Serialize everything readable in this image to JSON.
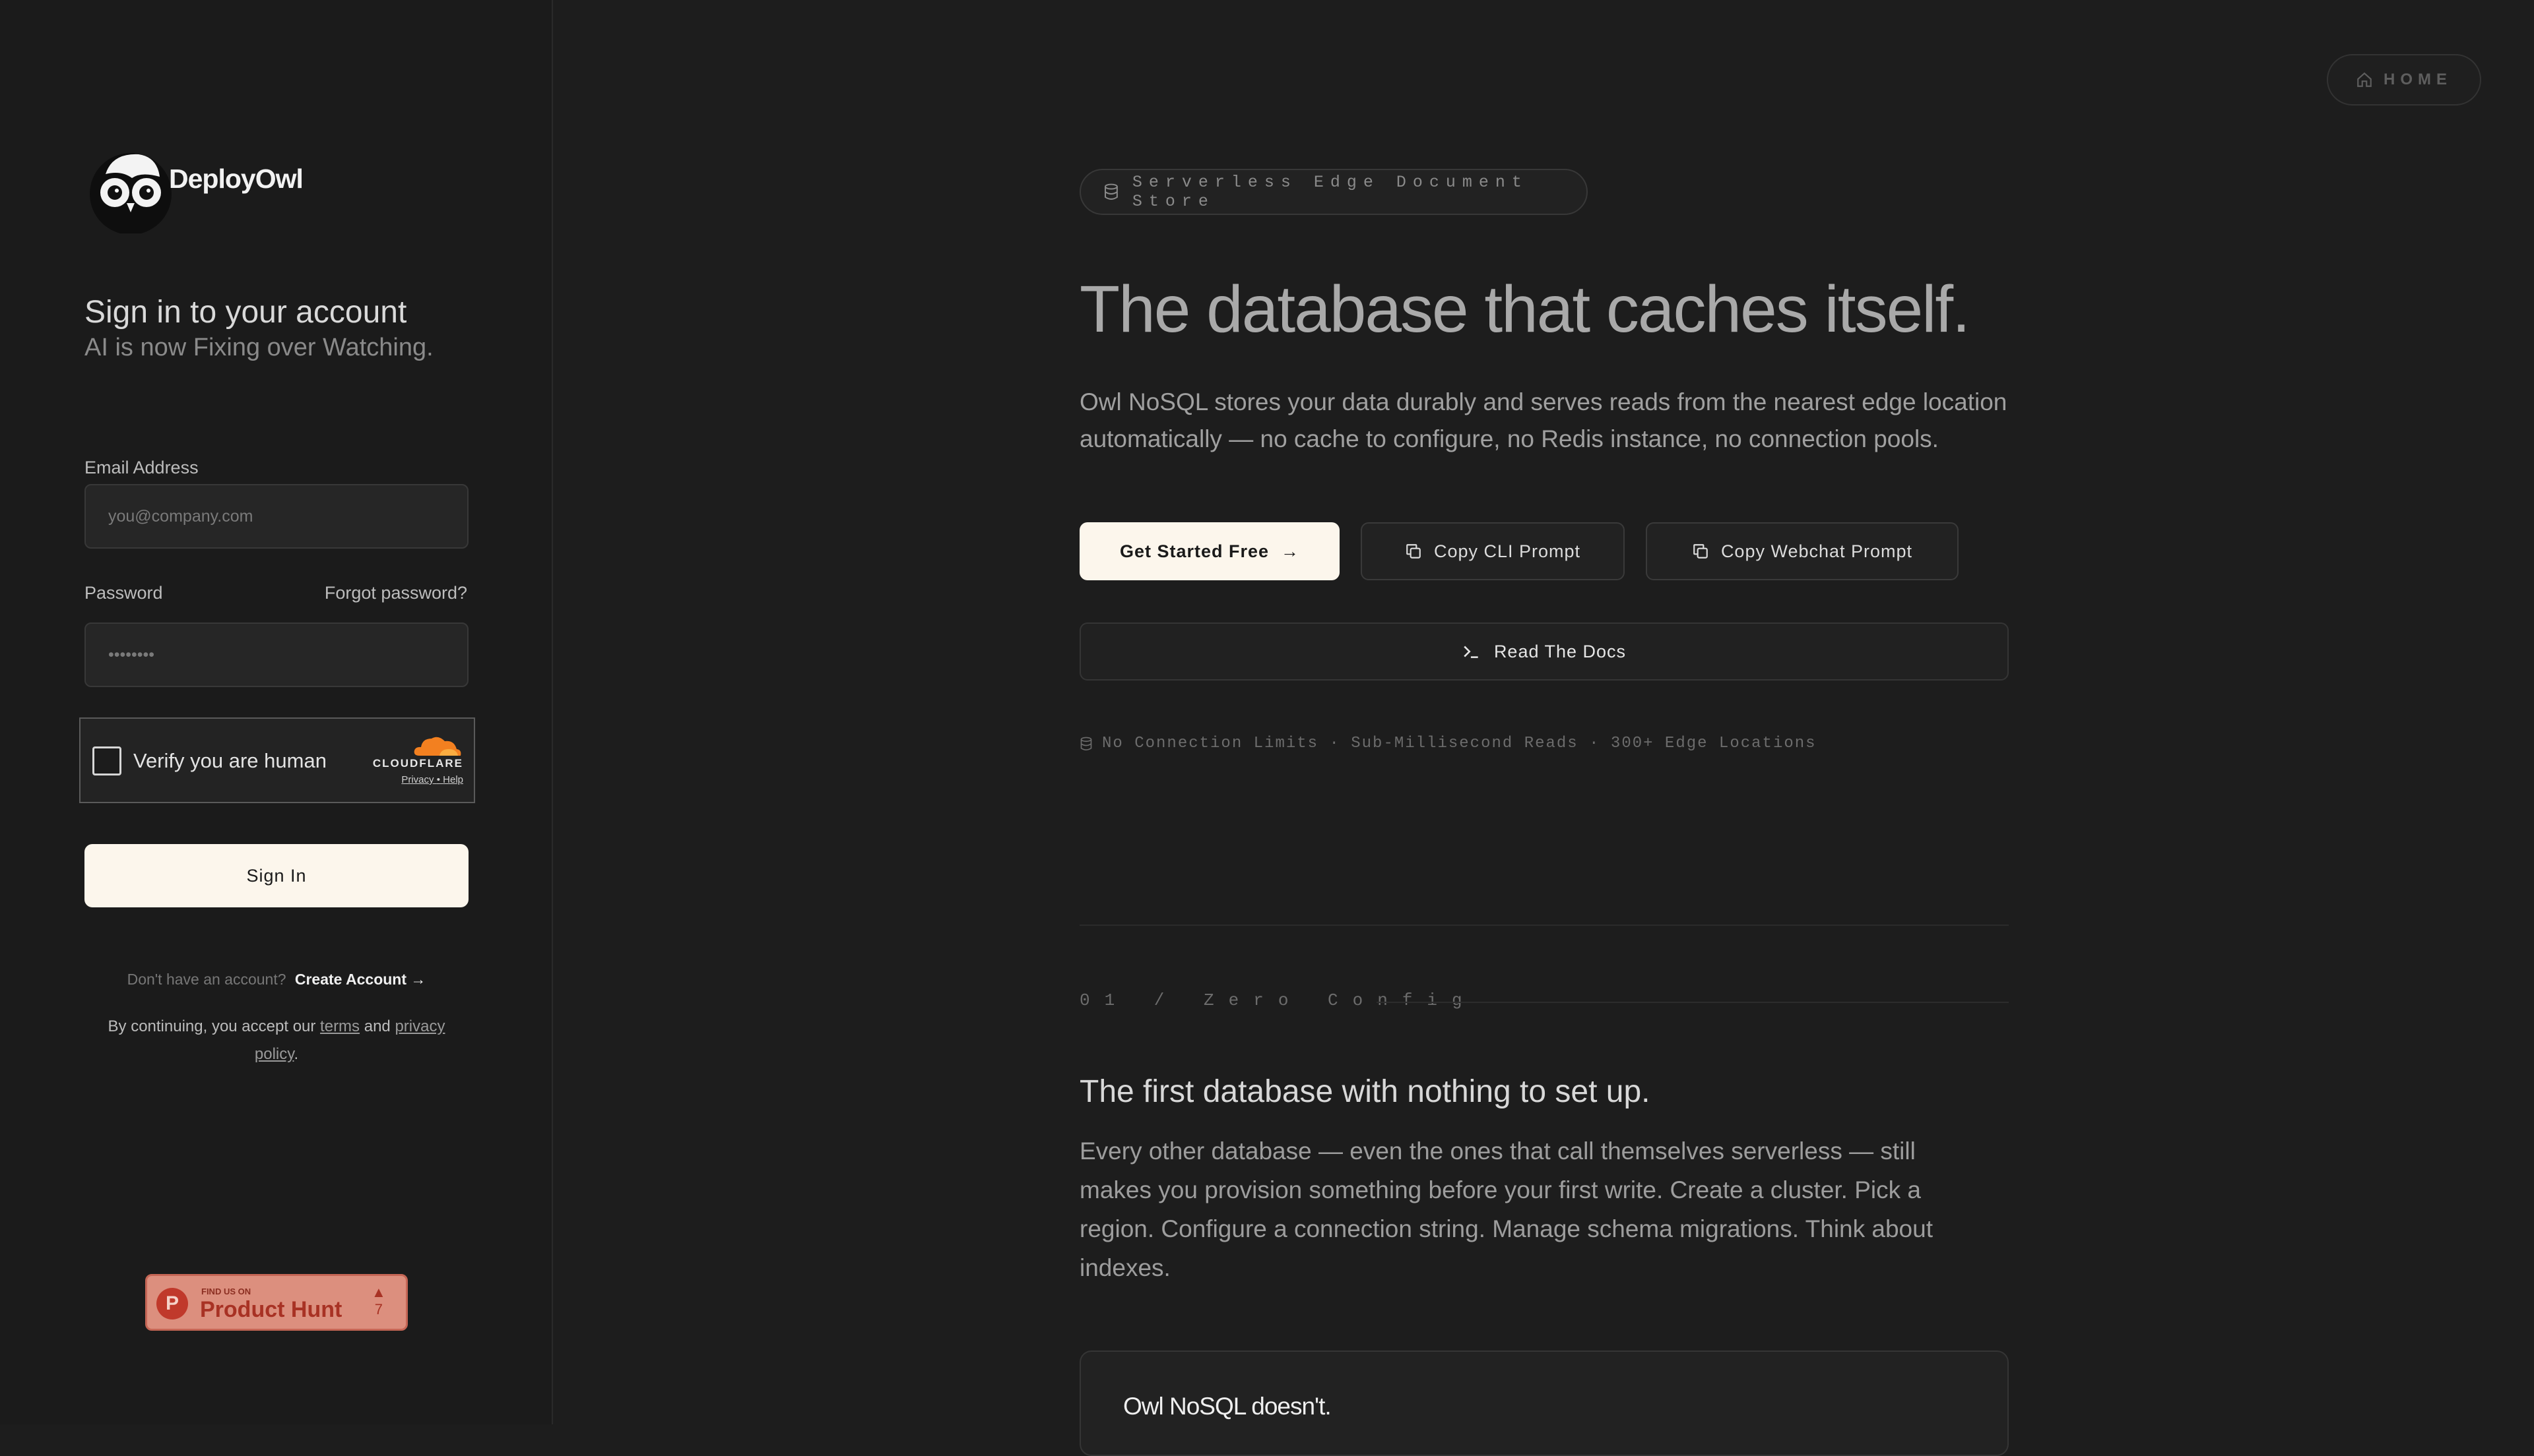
{
  "auth": {
    "brand": "DeployOwl",
    "title": "Sign in to your account",
    "subtitle": "AI is now Fixing over Watching.",
    "email_label": "Email Address",
    "email_placeholder": "you@company.com",
    "password_label": "Password",
    "forgot": "Forgot password?",
    "password_value": "••••••••",
    "captcha_label": "Verify you are human",
    "captcha_brand": "CLOUDFLARE",
    "captcha_privacy": "Privacy",
    "captcha_sep": "•",
    "captcha_help": "Help",
    "signin_button": "Sign In",
    "no_account": "Don't have an account?",
    "create_account": "Create Account",
    "terms_prefix": "By continuing, you accept our",
    "terms_link": "terms",
    "terms_and": "and",
    "privacy_link": "privacy policy",
    "terms_suffix": "."
  },
  "product_hunt": {
    "find": "FIND US ON",
    "name": "Product Hunt",
    "votes": "7"
  },
  "nav": {
    "home": "HOME"
  },
  "hero": {
    "badge": "Serverless Edge Document Store",
    "title": "The database that caches itself.",
    "description": "Owl NoSQL stores your data durably and serves reads from the nearest edge location automatically — no cache to configure, no Redis instance, no connection pools.",
    "get_started": "Get Started Free",
    "copy_cli": "Copy CLI Prompt",
    "copy_webchat": "Copy Webchat Prompt",
    "read_docs": "Read The Docs",
    "stats": "No Connection Limits · Sub-Millisecond Reads · 300+ Edge Locations"
  },
  "section": {
    "label": "01 / Zero Config",
    "title": "The first database with nothing to set up.",
    "body": "Every other database — even the ones that call themselves serverless — still makes you provision something before your first write. Create a cluster. Pick a region. Configure a connection string. Manage schema migrations. Think about indexes.",
    "card_title": "Owl NoSQL doesn't."
  },
  "colors": {
    "background": "#1d1d1d",
    "accent_cream": "#fcf6ec",
    "product_hunt": "#dc8f7e",
    "cloudflare_orange": "#f38020"
  }
}
